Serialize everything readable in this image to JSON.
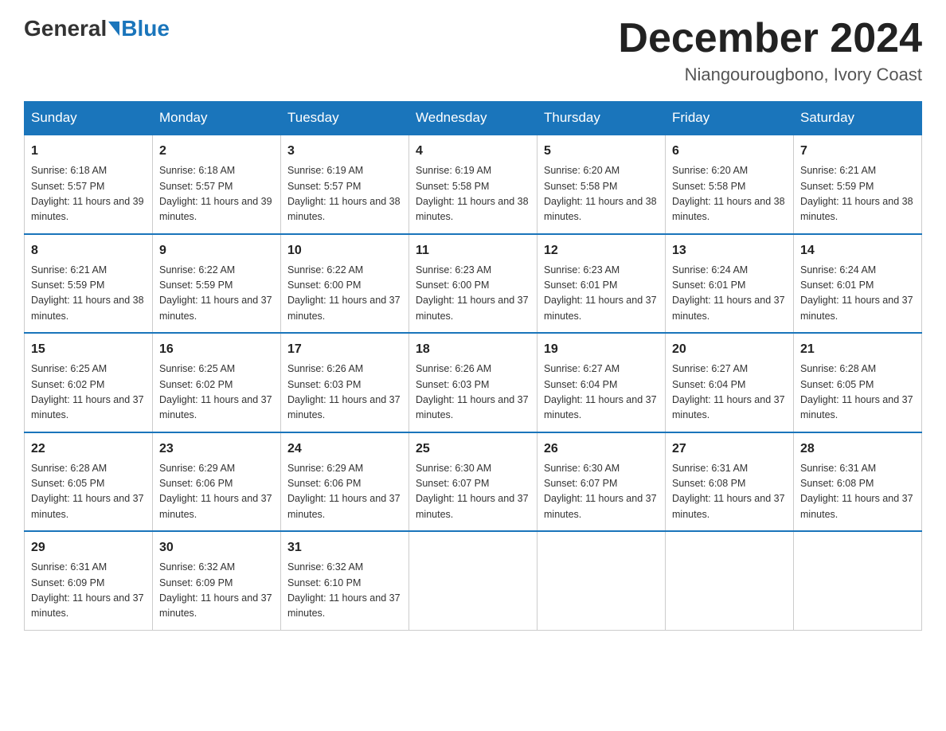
{
  "header": {
    "logo_general": "General",
    "logo_blue": "Blue",
    "month_year": "December 2024",
    "location": "Niangourougbono, Ivory Coast"
  },
  "days_of_week": [
    "Sunday",
    "Monday",
    "Tuesday",
    "Wednesday",
    "Thursday",
    "Friday",
    "Saturday"
  ],
  "weeks": [
    [
      {
        "day": "1",
        "sunrise": "6:18 AM",
        "sunset": "5:57 PM",
        "daylight": "11 hours and 39 minutes."
      },
      {
        "day": "2",
        "sunrise": "6:18 AM",
        "sunset": "5:57 PM",
        "daylight": "11 hours and 39 minutes."
      },
      {
        "day": "3",
        "sunrise": "6:19 AM",
        "sunset": "5:57 PM",
        "daylight": "11 hours and 38 minutes."
      },
      {
        "day": "4",
        "sunrise": "6:19 AM",
        "sunset": "5:58 PM",
        "daylight": "11 hours and 38 minutes."
      },
      {
        "day": "5",
        "sunrise": "6:20 AM",
        "sunset": "5:58 PM",
        "daylight": "11 hours and 38 minutes."
      },
      {
        "day": "6",
        "sunrise": "6:20 AM",
        "sunset": "5:58 PM",
        "daylight": "11 hours and 38 minutes."
      },
      {
        "day": "7",
        "sunrise": "6:21 AM",
        "sunset": "5:59 PM",
        "daylight": "11 hours and 38 minutes."
      }
    ],
    [
      {
        "day": "8",
        "sunrise": "6:21 AM",
        "sunset": "5:59 PM",
        "daylight": "11 hours and 38 minutes."
      },
      {
        "day": "9",
        "sunrise": "6:22 AM",
        "sunset": "5:59 PM",
        "daylight": "11 hours and 37 minutes."
      },
      {
        "day": "10",
        "sunrise": "6:22 AM",
        "sunset": "6:00 PM",
        "daylight": "11 hours and 37 minutes."
      },
      {
        "day": "11",
        "sunrise": "6:23 AM",
        "sunset": "6:00 PM",
        "daylight": "11 hours and 37 minutes."
      },
      {
        "day": "12",
        "sunrise": "6:23 AM",
        "sunset": "6:01 PM",
        "daylight": "11 hours and 37 minutes."
      },
      {
        "day": "13",
        "sunrise": "6:24 AM",
        "sunset": "6:01 PM",
        "daylight": "11 hours and 37 minutes."
      },
      {
        "day": "14",
        "sunrise": "6:24 AM",
        "sunset": "6:01 PM",
        "daylight": "11 hours and 37 minutes."
      }
    ],
    [
      {
        "day": "15",
        "sunrise": "6:25 AM",
        "sunset": "6:02 PM",
        "daylight": "11 hours and 37 minutes."
      },
      {
        "day": "16",
        "sunrise": "6:25 AM",
        "sunset": "6:02 PM",
        "daylight": "11 hours and 37 minutes."
      },
      {
        "day": "17",
        "sunrise": "6:26 AM",
        "sunset": "6:03 PM",
        "daylight": "11 hours and 37 minutes."
      },
      {
        "day": "18",
        "sunrise": "6:26 AM",
        "sunset": "6:03 PM",
        "daylight": "11 hours and 37 minutes."
      },
      {
        "day": "19",
        "sunrise": "6:27 AM",
        "sunset": "6:04 PM",
        "daylight": "11 hours and 37 minutes."
      },
      {
        "day": "20",
        "sunrise": "6:27 AM",
        "sunset": "6:04 PM",
        "daylight": "11 hours and 37 minutes."
      },
      {
        "day": "21",
        "sunrise": "6:28 AM",
        "sunset": "6:05 PM",
        "daylight": "11 hours and 37 minutes."
      }
    ],
    [
      {
        "day": "22",
        "sunrise": "6:28 AM",
        "sunset": "6:05 PM",
        "daylight": "11 hours and 37 minutes."
      },
      {
        "day": "23",
        "sunrise": "6:29 AM",
        "sunset": "6:06 PM",
        "daylight": "11 hours and 37 minutes."
      },
      {
        "day": "24",
        "sunrise": "6:29 AM",
        "sunset": "6:06 PM",
        "daylight": "11 hours and 37 minutes."
      },
      {
        "day": "25",
        "sunrise": "6:30 AM",
        "sunset": "6:07 PM",
        "daylight": "11 hours and 37 minutes."
      },
      {
        "day": "26",
        "sunrise": "6:30 AM",
        "sunset": "6:07 PM",
        "daylight": "11 hours and 37 minutes."
      },
      {
        "day": "27",
        "sunrise": "6:31 AM",
        "sunset": "6:08 PM",
        "daylight": "11 hours and 37 minutes."
      },
      {
        "day": "28",
        "sunrise": "6:31 AM",
        "sunset": "6:08 PM",
        "daylight": "11 hours and 37 minutes."
      }
    ],
    [
      {
        "day": "29",
        "sunrise": "6:31 AM",
        "sunset": "6:09 PM",
        "daylight": "11 hours and 37 minutes."
      },
      {
        "day": "30",
        "sunrise": "6:32 AM",
        "sunset": "6:09 PM",
        "daylight": "11 hours and 37 minutes."
      },
      {
        "day": "31",
        "sunrise": "6:32 AM",
        "sunset": "6:10 PM",
        "daylight": "11 hours and 37 minutes."
      },
      null,
      null,
      null,
      null
    ]
  ],
  "labels": {
    "sunrise_prefix": "Sunrise: ",
    "sunset_prefix": "Sunset: ",
    "daylight_prefix": "Daylight: "
  }
}
